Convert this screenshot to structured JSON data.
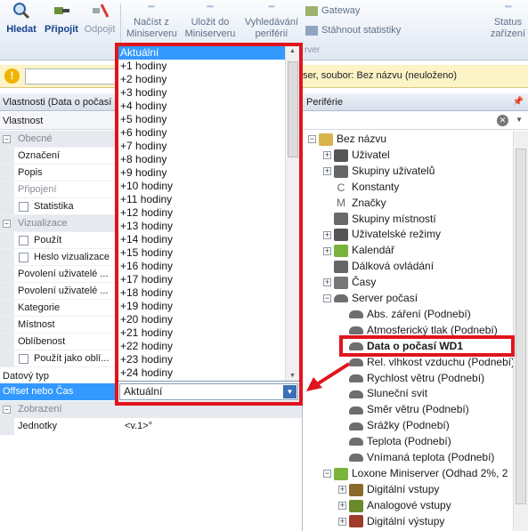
{
  "ribbon": {
    "search_label": "Hledat",
    "connect_label": "Připojit",
    "disconnect_label": "Odpojit",
    "load_label": "Načíst z\nMiniserveru",
    "save_label": "Uložit do\nMiniserveru",
    "discover_label": "Vyhledávání\nperiférií",
    "gateway_label": "Gateway",
    "download_stats_label": "Stáhnout statistiky",
    "status_label": "Status\nzařízení",
    "group_fragment": "rver"
  },
  "infobar": {
    "text": "ser, soubor: Bez názvu (neuloženo)"
  },
  "properties_panel": {
    "header": "Vlastnosti (Data o počasí",
    "column_header": "Vlastnost",
    "rows": [
      {
        "type": "category",
        "label": "Obecné"
      },
      {
        "type": "field",
        "label": "Označení"
      },
      {
        "type": "field",
        "label": "Popis"
      },
      {
        "type": "field_dim",
        "label": "Připojení"
      },
      {
        "type": "check",
        "label": "Statistika"
      },
      {
        "type": "category",
        "label": "Vizualizace"
      },
      {
        "type": "check",
        "label": "Použít"
      },
      {
        "type": "check",
        "label": "Heslo vizualizace"
      },
      {
        "type": "field",
        "label": "Povolení uživatelé ..."
      },
      {
        "type": "field",
        "label": "Povolení uživatelé ..."
      },
      {
        "type": "field",
        "label": "Kategorie"
      },
      {
        "type": "field",
        "label": "Místnost"
      },
      {
        "type": "field",
        "label": "Oblíbenost"
      },
      {
        "type": "check",
        "label": "Použít jako oblí..."
      }
    ],
    "datatype_label": "Datový typ",
    "offset_label": "Offset nebo Čas",
    "offset_value": "Aktuální",
    "display_category": "Zobrazení",
    "units_label": "Jednotky",
    "units_value": "<v.1>°"
  },
  "dropdown_options": [
    "Aktuální",
    "+1 hodiny",
    "+2 hodiny",
    "+3 hodiny",
    "+4 hodiny",
    "+5 hodiny",
    "+6 hodiny",
    "+7 hodiny",
    "+8 hodiny",
    "+9 hodiny",
    "+10 hodiny",
    "+11 hodiny",
    "+12 hodiny",
    "+13 hodiny",
    "+14 hodiny",
    "+15 hodiny",
    "+16 hodiny",
    "+17 hodiny",
    "+18 hodiny",
    "+19 hodiny",
    "+20 hodiny",
    "+21 hodiny",
    "+22 hodiny",
    "+23 hodiny",
    "+24 hodiny"
  ],
  "peripheral_panel": {
    "header": "Periférie",
    "pin_icon": "pin-icon",
    "tree": [
      {
        "label": "Bez názvu",
        "indent": 0,
        "exp": "−",
        "icon": "project-icon"
      },
      {
        "label": "Uživatel",
        "indent": 1,
        "exp": "+",
        "icon": "user-icon"
      },
      {
        "label": "Skupiny uživatelů",
        "indent": 1,
        "exp": "+",
        "icon": "users-icon"
      },
      {
        "label": "Konstanty",
        "indent": 1,
        "exp": "",
        "icon": "constant-icon"
      },
      {
        "label": "Značky",
        "indent": 1,
        "exp": "",
        "icon": "marker-icon"
      },
      {
        "label": "Skupiny místností",
        "indent": 1,
        "exp": "",
        "icon": "house-icon"
      },
      {
        "label": "Uživatelské režimy",
        "indent": 1,
        "exp": "+",
        "icon": "mode-icon"
      },
      {
        "label": "Kalendář",
        "indent": 1,
        "exp": "+",
        "icon": "calendar-icon"
      },
      {
        "label": "Dálková ovládání",
        "indent": 1,
        "exp": "",
        "icon": "remote-icon"
      },
      {
        "label": "Časy",
        "indent": 1,
        "exp": "+",
        "icon": "clock-icon"
      },
      {
        "label": "Server počasí",
        "indent": 1,
        "exp": "−",
        "icon": "cloud-icon"
      },
      {
        "label": "Abs. záření (Podnebí)",
        "indent": 2,
        "exp": "",
        "icon": "cloud-icon"
      },
      {
        "label": "Atmosferický tlak (Podnebí)",
        "indent": 2,
        "exp": "",
        "icon": "cloud-icon"
      },
      {
        "label": "Data o počasí WD1",
        "indent": 2,
        "exp": "",
        "icon": "cloud-icon",
        "bold": true
      },
      {
        "label": "Rel. vlhkost vzduchu (Podnebí)",
        "indent": 2,
        "exp": "",
        "icon": "cloud-icon"
      },
      {
        "label": "Rychlost větru (Podnebí)",
        "indent": 2,
        "exp": "",
        "icon": "cloud-icon"
      },
      {
        "label": "Sluneční svit",
        "indent": 2,
        "exp": "",
        "icon": "cloud-icon"
      },
      {
        "label": "Směr větru (Podnebí)",
        "indent": 2,
        "exp": "",
        "icon": "cloud-icon"
      },
      {
        "label": "Srážky (Podnebí)",
        "indent": 2,
        "exp": "",
        "icon": "cloud-icon"
      },
      {
        "label": "Teplota (Podnebí)",
        "indent": 2,
        "exp": "",
        "icon": "cloud-icon"
      },
      {
        "label": "Vnímaná teplota (Podnebí)",
        "indent": 2,
        "exp": "",
        "icon": "cloud-icon"
      },
      {
        "label": "Loxone Miniserver (Odhad 2%, 2",
        "indent": 1,
        "exp": "−",
        "icon": "miniserver-icon"
      },
      {
        "label": "Digitální vstupy",
        "indent": 2,
        "exp": "+",
        "icon": "digital-in-icon"
      },
      {
        "label": "Analogové vstupy",
        "indent": 2,
        "exp": "+",
        "icon": "analog-in-icon"
      },
      {
        "label": "Digitální výstupy",
        "indent": 2,
        "exp": "+",
        "icon": "digital-out-icon"
      }
    ]
  },
  "colors": {
    "highlight": "#e0141c",
    "selection": "#3399ff",
    "ribbon_text": "#15428b"
  }
}
